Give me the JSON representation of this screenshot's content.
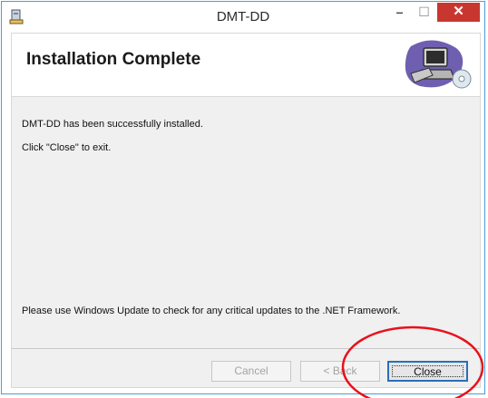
{
  "window": {
    "title": "DMT-DD"
  },
  "titlebar": {
    "minimize_glyph": "–",
    "maximize_glyph": "☐",
    "close_glyph": "✕"
  },
  "banner": {
    "title": "Installation Complete",
    "image": "computer-disc-icon"
  },
  "content": {
    "line1": "DMT-DD has been successfully installed.",
    "line2": "Click \"Close\" to exit.",
    "line3": "Please use Windows Update to check for any critical updates to the .NET Framework."
  },
  "buttons": {
    "cancel": "Cancel",
    "back": "< Back",
    "close": "Close"
  },
  "annotation": {
    "color": "#e8111b"
  }
}
